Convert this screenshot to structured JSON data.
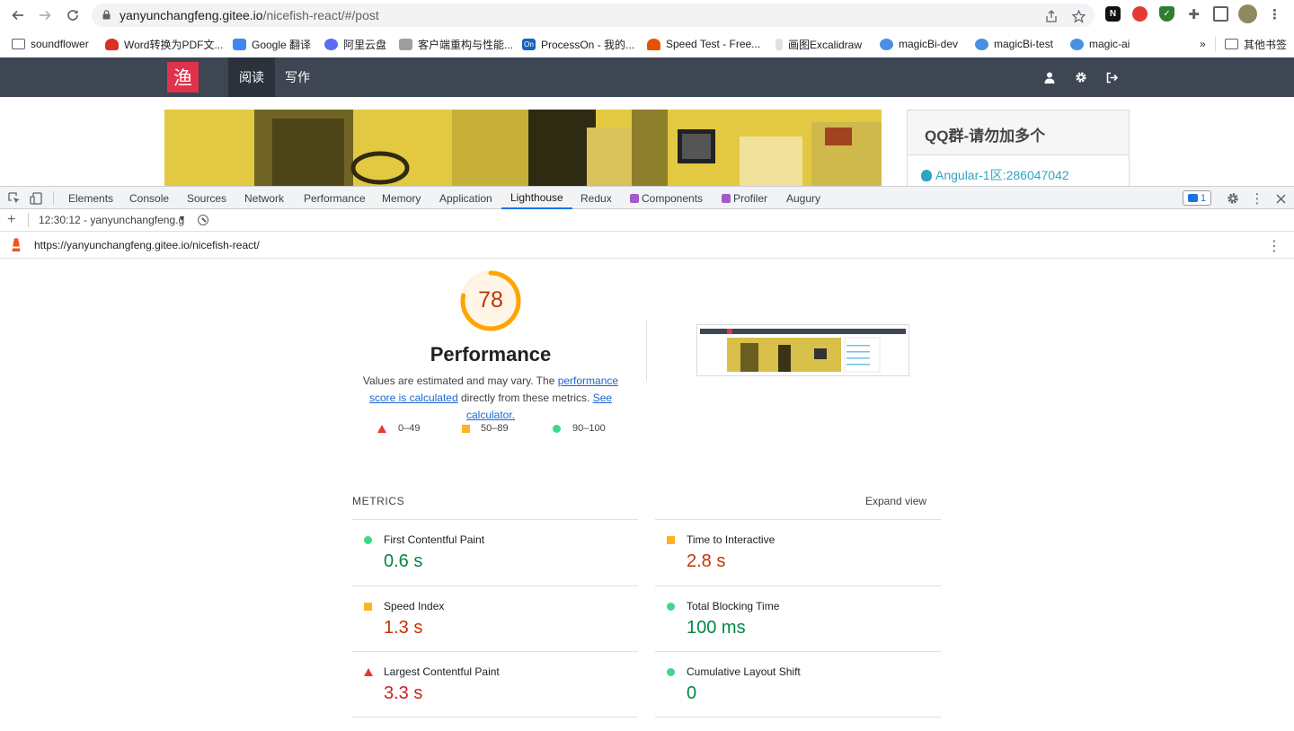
{
  "browser": {
    "url_host": "yanyunchangfeng.gitee.io",
    "url_path": "/nicefish-react/#/post",
    "bookmarks": [
      {
        "label": "soundflower",
        "color": "#5f6368"
      },
      {
        "label": "Word转换为PDF文...",
        "color": "#d93025"
      },
      {
        "label": "Google 翻译",
        "color": "#4285f4"
      },
      {
        "label": "阿里云盘",
        "color": "#5b6cf0"
      },
      {
        "label": "客户端重构与性能...",
        "color": "#9e9e9e"
      },
      {
        "label": "ProcessOn - 我的...",
        "color": "#1565c0"
      },
      {
        "label": "Speed Test - Free...",
        "color": "#e65100"
      },
      {
        "label": "画图Excalidraw",
        "color": "#bdbdbd"
      },
      {
        "label": "magicBi-dev",
        "color": "#4a90e2"
      },
      {
        "label": "magicBi-test",
        "color": "#4a90e2"
      },
      {
        "label": "magic-ai",
        "color": "#4a90e2"
      }
    ],
    "overflow_label": "»",
    "other_bookmarks": "其他书签"
  },
  "site": {
    "logo_text": "渔",
    "nav": [
      "阅读",
      "写作"
    ],
    "side_title": "QQ群-请勿加多个",
    "side_link": "Angular-1区:286047042"
  },
  "devtools": {
    "tabs": [
      "Elements",
      "Console",
      "Sources",
      "Network",
      "Performance",
      "Memory",
      "Application",
      "Lighthouse",
      "Redux",
      "Components",
      "Profiler",
      "Augury"
    ],
    "active_tab": "Lighthouse",
    "message_count": "1",
    "report_selector": "12:30:12 - yanyunchangfeng.g",
    "report_url": "https://yanyunchangfeng.gitee.io/nicefish-react/"
  },
  "lighthouse": {
    "score": 78,
    "score_color": "#ffa400",
    "category": "Performance",
    "desc_text_1": "Values are estimated and may vary. The ",
    "desc_link_1": "performance score is calculated",
    "desc_text_2": " directly from these metrics. ",
    "desc_link_2": "See calculator.",
    "legend": {
      "fail": "0–49",
      "average": "50–89",
      "pass": "90–100"
    },
    "metrics_title": "METRICS",
    "expand_label": "Expand view",
    "metrics": [
      {
        "label": "First Contentful Paint",
        "value": "0.6 s",
        "rating": "pass"
      },
      {
        "label": "Time to Interactive",
        "value": "2.8 s",
        "rating": "average"
      },
      {
        "label": "Speed Index",
        "value": "1.3 s",
        "rating": "average"
      },
      {
        "label": "Total Blocking Time",
        "value": "100 ms",
        "rating": "pass"
      },
      {
        "label": "Largest Contentful Paint",
        "value": "3.3 s",
        "rating": "fail"
      },
      {
        "label": "Cumulative Layout Shift",
        "value": "0",
        "rating": "pass"
      }
    ]
  }
}
